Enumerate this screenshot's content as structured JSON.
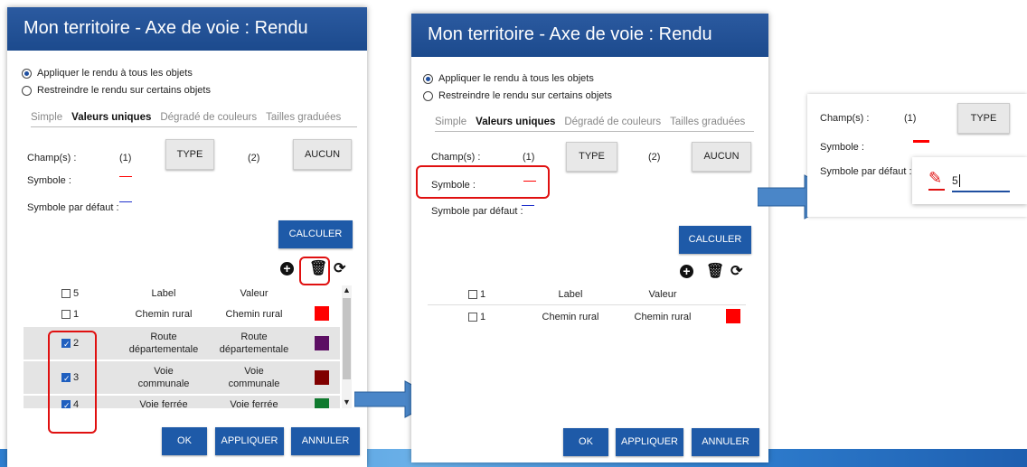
{
  "dialog_title": "Mon territoire - Axe de voie : Rendu",
  "radios": {
    "all": "Appliquer le rendu à tous les objets",
    "restrict": "Restreindre le rendu sur certains objets"
  },
  "tabs": [
    "Simple",
    "Valeurs uniques",
    "Dégradé de couleurs",
    "Tailles graduées"
  ],
  "fields": {
    "champs_label": "Champ(s) :",
    "one": "(1)",
    "two": "(2)",
    "type_btn": "TYPE",
    "aucun_btn": "AUCUN",
    "symbole_label": "Symbole :",
    "symbole_defaut_label": "Symbole par défaut :"
  },
  "buttons": {
    "calculer": "CALCULER",
    "ok": "OK",
    "appliquer": "APPLIQUER",
    "annuler": "ANNULER"
  },
  "table_headers": {
    "label": "Label",
    "valeur": "Valeur"
  },
  "left_table": {
    "header_count": "5",
    "rows": [
      {
        "num": "1",
        "label": "Chemin rural",
        "valeur": "Chemin rural",
        "color": "#ff0000",
        "checked": false
      },
      {
        "num": "2",
        "label": "Route départementale",
        "valeur": "Route départementale",
        "color": "#5c0f63",
        "checked": true
      },
      {
        "num": "3",
        "label": "Voie communale",
        "valeur": "Voie communale",
        "color": "#800000",
        "checked": true
      },
      {
        "num": "4",
        "label": "Voie ferrée",
        "valeur": "Voie ferrée",
        "color": "#0f7a2e",
        "checked": true
      }
    ]
  },
  "middle_table": {
    "header_count": "1",
    "rows": [
      {
        "num": "1",
        "label": "Chemin rural",
        "valeur": "Chemin rural",
        "color": "#ff0000",
        "checked": false
      }
    ]
  },
  "right_panel": {
    "champs_label": "Champ(s) :",
    "one": "(1)",
    "type_btn": "TYPE",
    "symbole_label": "Symbole :",
    "symbole_defaut_label": "Symbole par défaut :",
    "input_value": "5"
  },
  "colors": {
    "title_bar": "#1c4a8d",
    "accent_blue": "#1e5aa8",
    "highlight_red": "#e01010",
    "symbol_red": "#ff0000",
    "symbol_blue": "#2233cc"
  },
  "icons": [
    "add-circle-icon",
    "trash-icon",
    "refresh-icon",
    "pencil-icon",
    "arrow-right-icon"
  ]
}
